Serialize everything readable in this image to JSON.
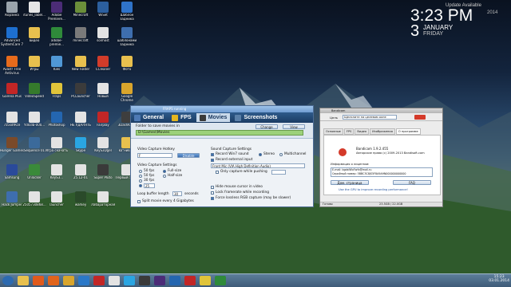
{
  "clock": {
    "header": "Update Available",
    "time": "3:23 PM",
    "year": "2014",
    "day": "3",
    "month": "JANUARY",
    "weekday": "FRIDAY"
  },
  "desktop_icons": [
    {
      "label": "Корзина",
      "color": "#9aa4ad"
    },
    {
      "label": "itunes_label...",
      "color": "#e6e6e6"
    },
    {
      "label": "Adobe Premiere...",
      "color": "#4b2c77"
    },
    {
      "label": "Minecraft",
      "color": "#6b8f3a"
    },
    {
      "label": "WiSet",
      "color": "#2c5f9e"
    },
    {
      "label": "Шаблон задника",
      "color": "#2f73c9"
    },
    {
      "label": "Advanced SystemCare 7",
      "color": "#1d6fd0"
    },
    {
      "label": "видео",
      "color": "#e8c04e"
    },
    {
      "label": "adobe-premie...",
      "color": "#2f8a3a"
    },
    {
      "label": "minecraft",
      "color": "#7a7a7a"
    },
    {
      "label": "sonhost",
      "color": "#e3e3e3"
    },
    {
      "label": "шаблонами задника",
      "color": "#3e6eae"
    },
    {
      "label": "Avast! Free Antivirus",
      "color": "#e76b1c"
    },
    {
      "label": "Игры",
      "color": "#e8c04e"
    },
    {
      "label": "Kies",
      "color": "#5098d6"
    },
    {
      "label": "New Folder",
      "color": "#e8c04e"
    },
    {
      "label": "CCleaner",
      "color": "#d23c2a"
    },
    {
      "label": "Фото",
      "color": "#e8c04e"
    },
    {
      "label": "Garena Plus",
      "color": "#c22626"
    },
    {
      "label": "VideoSpeed",
      "color": "#357a2c"
    },
    {
      "label": "Fraps",
      "color": "#e0c43a"
    },
    {
      "label": "PCLauncher",
      "color": "#3b3b3b"
    },
    {
      "label": "Новый",
      "color": "#e3e3e3"
    },
    {
      "label": "Google Chrome",
      "color": "#d9a52c"
    },
    {
      "label": "7z5sdfRce",
      "color": "#e3e3e3"
    },
    {
      "label": "Ydlcdb-000...",
      "color": "#e3e3e3"
    },
    {
      "label": "Photoshop",
      "color": "#2466b0"
    },
    {
      "label": "НЕ УДАЛЯТЬ",
      "color": "#e3e3e3"
    },
    {
      "label": "Fairplay",
      "color": "#c22626"
    },
    {
      "label": "3DashKiller",
      "color": "#3e3e3e"
    },
    {
      "label": "Hunger Games",
      "color": "#7a4a2a"
    },
    {
      "label": "Sequence 01",
      "color": "#3b6a9b"
    },
    {
      "label": "Игра скачать",
      "color": "#e3e3e3"
    },
    {
      "label": "Skype",
      "color": "#2aa5e2"
    },
    {
      "label": "KeyS3Dgel",
      "color": "#e3e3e3"
    },
    {
      "label": "ko\"нив\"ру",
      "color": "#e8c04e"
    },
    {
      "label": "Samsung",
      "color": "#2a4a9a"
    },
    {
      "label": "Unlocker",
      "color": "#3a8a3a"
    },
    {
      "label": "KeyS3...",
      "color": "#e3e3e3"
    },
    {
      "label": "25.12-01",
      "color": "#e3e3e3"
    },
    {
      "label": "Super Pluto",
      "color": "#3a3a3a"
    },
    {
      "label": "Первый заказ",
      "color": "#e3e3e3"
    },
    {
      "label": "Hack Jumper",
      "color": "#3e6eae"
    },
    {
      "label": "2505730868...",
      "color": "#e3e3e3"
    },
    {
      "label": "launcher",
      "color": "#e3e3e3"
    },
    {
      "label": "warkey",
      "color": "#2a4a2a"
    },
    {
      "label": "Лабараторная",
      "color": "#e3e3e3"
    }
  ],
  "fraps": {
    "title": "FRAPS running",
    "tabs": [
      {
        "label": "General",
        "color": "#4d79b4"
      },
      {
        "label": "FPS",
        "color": "#e4b620"
      },
      {
        "label": "Movies",
        "color": "#3a3a3a"
      },
      {
        "label": "Screenshots",
        "color": "#5a7fa8"
      }
    ],
    "folder_label": "Folder to save movies in",
    "folder_path": "D:\\Games\\Movies",
    "change_button": "Change",
    "view_button": "View",
    "hotkey_label": "Video Capture Hotkey",
    "hotkey_value": "F",
    "disable_button": "Disable",
    "settings_label": "Video Capture Settings",
    "fps_options": [
      "50 fps",
      "50 fps",
      "30 fps",
      "25"
    ],
    "size_options": [
      "Full-size",
      "Half-size"
    ],
    "buffer_label": "Loop buffer length",
    "buffer_value": "30",
    "buffer_unit": "seconds",
    "split_label": "Split movie every 4 Gigabytes",
    "sound_label": "Sound Capture Settings",
    "record_sound": "Record Win7 sound",
    "stereo": "Stereo",
    "multichannel": "Multichannel",
    "external_input": "Record external input",
    "device": "Front Mic (VIA High Definition Audio)",
    "push_label": "Only capture while pushing",
    "hide_cursor": "Hide mouse cursor in video",
    "lock_framerate": "Lock framerate while recording",
    "force_rgb": "Force lossless RGB capture (may be slower)"
  },
  "bandicam": {
    "title": "Bandicam",
    "target_label": "Цель",
    "target_text": "Щелкните на целевом окне",
    "tabs": [
      "Основные",
      "FPS",
      "Видео",
      "Изображения",
      "О программе"
    ],
    "version": "Bandicam 1.9.2.455",
    "copyright": "Авторские права (c) 2009-2013 Bandisoft.com",
    "reg_info": "Информация о лицензии:",
    "email": "E-mail: bgdsfWxFwfx@mail.ru",
    "serial": "Серийный номер: 5BBC3C8JS5F8A9A9N000000000000",
    "homepage_button": "Дом. страница",
    "faq_button": "FAQ",
    "gpu_tip": "Use the GPU to improve recording performance!",
    "status": "Готово",
    "status_size": "23.5GB / 22.0GB"
  },
  "taskbar": {
    "apps": [
      {
        "name": "start",
        "color": "#2c6ab0"
      },
      {
        "name": "explorer",
        "color": "#e8c04e"
      },
      {
        "name": "media",
        "color": "#e05a1c"
      },
      {
        "name": "firefox",
        "color": "#e0641c"
      },
      {
        "name": "chrome",
        "color": "#d9a52c"
      },
      {
        "name": "ie",
        "color": "#2a78c8"
      },
      {
        "name": "opera",
        "color": "#c22626"
      },
      {
        "name": "yandex",
        "color": "#e3e3e3"
      },
      {
        "name": "skype",
        "color": "#2aa5e2"
      },
      {
        "name": "games",
        "color": "#3a3a3a"
      },
      {
        "name": "premiere",
        "color": "#4b2c77"
      },
      {
        "name": "photoshop",
        "color": "#2466b0"
      },
      {
        "name": "bandicam",
        "color": "#c22626"
      },
      {
        "name": "fraps",
        "color": "#e0c43a"
      },
      {
        "name": "utorrent",
        "color": "#2f8a3a"
      }
    ],
    "clock_time": "15:23",
    "clock_date": "03.01.2014"
  }
}
